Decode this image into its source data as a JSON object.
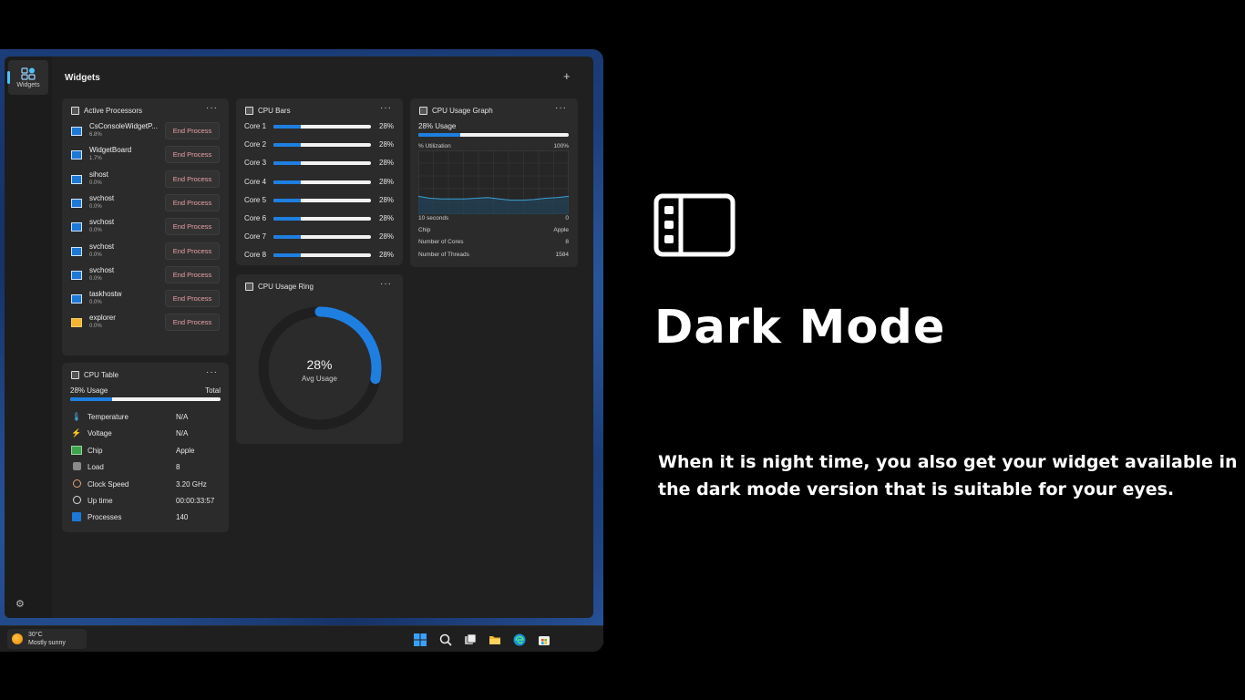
{
  "app": {
    "rail_label": "Widgets",
    "title": "Widgets",
    "add_label": "+",
    "settings_icon": "gear-icon"
  },
  "active_processors": {
    "title": "Active Processors",
    "menu": "···",
    "items": [
      {
        "name": "CsConsoleWidgetP...",
        "value": "6.8%",
        "action": "End Process"
      },
      {
        "name": "WidgetBoard",
        "value": "1.7%",
        "action": "End Process"
      },
      {
        "name": "sihost",
        "value": "0.0%",
        "action": "End Process"
      },
      {
        "name": "svchost",
        "value": "0.0%",
        "action": "End Process"
      },
      {
        "name": "svchost",
        "value": "0.0%",
        "action": "End Process"
      },
      {
        "name": "svchost",
        "value": "0.0%",
        "action": "End Process"
      },
      {
        "name": "svchost",
        "value": "0.0%",
        "action": "End Process"
      },
      {
        "name": "taskhostw",
        "value": "0.0%",
        "action": "End Process"
      },
      {
        "name": "explorer",
        "value": "0.0%",
        "action": "End Process"
      }
    ]
  },
  "cpu_bars": {
    "title": "CPU Bars",
    "menu": "···",
    "cores": [
      {
        "label": "Core 1",
        "percent": "28%",
        "fraction": 0.28
      },
      {
        "label": "Core 2",
        "percent": "28%",
        "fraction": 0.28
      },
      {
        "label": "Core 3",
        "percent": "28%",
        "fraction": 0.28
      },
      {
        "label": "Core 4",
        "percent": "28%",
        "fraction": 0.28
      },
      {
        "label": "Core 5",
        "percent": "28%",
        "fraction": 0.28
      },
      {
        "label": "Core 6",
        "percent": "28%",
        "fraction": 0.28
      },
      {
        "label": "Core 7",
        "percent": "28%",
        "fraction": 0.28
      },
      {
        "label": "Core 8",
        "percent": "28%",
        "fraction": 0.28
      }
    ]
  },
  "cpu_graph": {
    "title": "CPU Usage Graph",
    "menu": "···",
    "usage": "28% Usage",
    "usage_fraction": 0.28,
    "y_label": "% Utilization",
    "y_max": "100%",
    "x_label": "10 seconds",
    "y_min": "0",
    "series": [
      28,
      25,
      24,
      24,
      24,
      25,
      26,
      24,
      22,
      22,
      23,
      25,
      26,
      28
    ],
    "rows": [
      {
        "label": "Chip",
        "value": "Apple"
      },
      {
        "label": "Number of Cores",
        "value": "8"
      },
      {
        "label": "Number of Threads",
        "value": "1584"
      }
    ]
  },
  "cpu_ring": {
    "title": "CPU Usage Ring",
    "menu": "···",
    "percent": "28%",
    "fraction": 0.28,
    "caption": "Avg Usage"
  },
  "cpu_table": {
    "title": "CPU Table",
    "menu": "···",
    "usage": "28% Usage",
    "usage_fraction": 0.28,
    "total": "Total",
    "rows": [
      {
        "icon": "thermometer-icon",
        "label": "Temperature",
        "value": "N/A"
      },
      {
        "icon": "lightning-icon",
        "label": "Voltage",
        "value": "N/A"
      },
      {
        "icon": "chip-icon",
        "label": "Chip",
        "value": "Apple"
      },
      {
        "icon": "load-icon",
        "label": "Load",
        "value": "8"
      },
      {
        "icon": "speedometer-icon",
        "label": "Clock Speed",
        "value": "3.20 GHz"
      },
      {
        "icon": "clock-icon",
        "label": "Up time",
        "value": "00:00:33:57"
      },
      {
        "icon": "processes-icon",
        "label": "Processes",
        "value": "140"
      }
    ]
  },
  "taskbar": {
    "weather_temp": "30°C",
    "weather_desc": "Mostly sunny"
  },
  "hero": {
    "title": "Dark Mode",
    "description": "When it is night time, you also get your widget available in the dark mode version that is suitable for your eyes."
  },
  "colors": {
    "accent": "#1e7fe0",
    "end_process_text": "#e9a0a6",
    "card": "#2b2b2b",
    "app_bg": "#202020"
  }
}
